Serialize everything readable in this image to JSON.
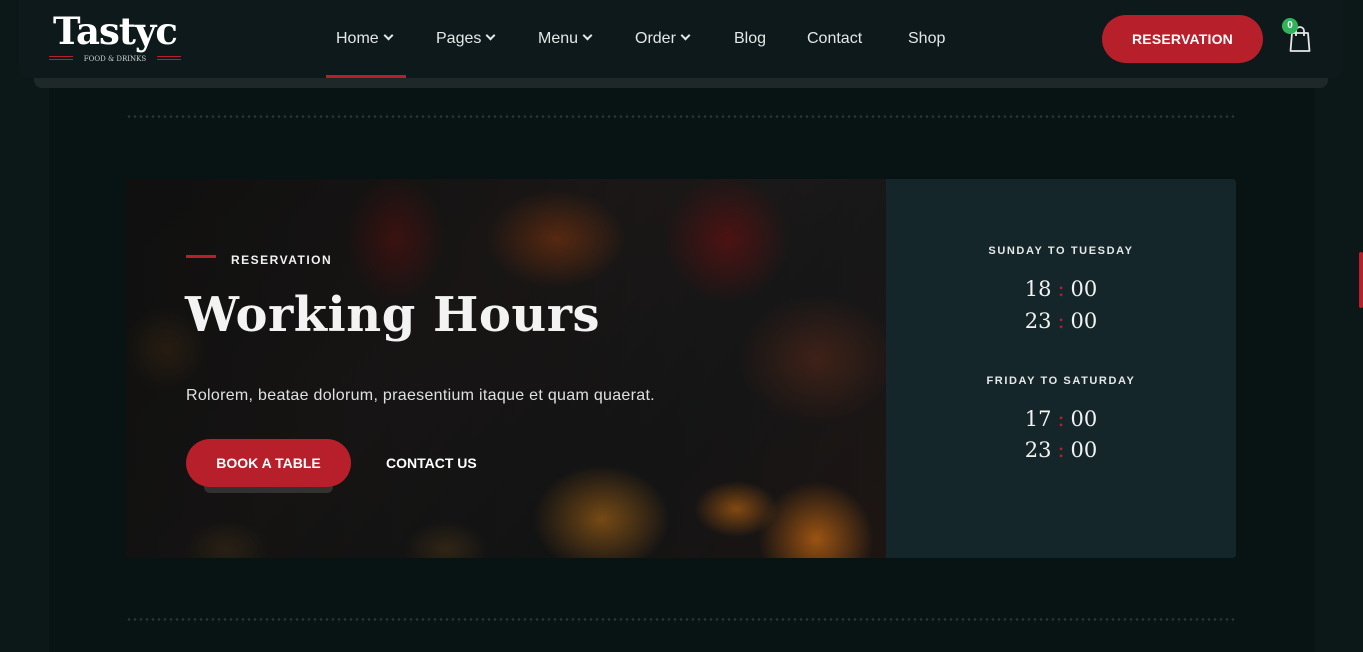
{
  "header": {
    "logo": {
      "name": "Tastyc",
      "tagline": "FOOD & DRINKS"
    },
    "nav": [
      {
        "label": "Home",
        "dropdown": true,
        "active": true
      },
      {
        "label": "Pages",
        "dropdown": true
      },
      {
        "label": "Menu",
        "dropdown": true
      },
      {
        "label": "Order",
        "dropdown": true
      },
      {
        "label": "Blog",
        "dropdown": false
      },
      {
        "label": "Contact",
        "dropdown": false
      },
      {
        "label": "Shop",
        "dropdown": false
      }
    ],
    "reservation_button": "RESERVATION",
    "cart": {
      "icon": "shopping-bag-icon",
      "count": "0"
    }
  },
  "hero": {
    "eyebrow": "RESERVATION",
    "title": "Working Hours",
    "description": "Rolorem, beatae dolorum, praesentium itaque et quam quaerat.",
    "book_button": "BOOK A TABLE",
    "contact_link": "CONTACT US"
  },
  "hours": [
    {
      "days": "SUNDAY TO TUESDAY",
      "open": {
        "h": "18",
        "m": "00"
      },
      "close": {
        "h": "23",
        "m": "00"
      }
    },
    {
      "days": "FRIDAY TO SATURDAY",
      "open": {
        "h": "17",
        "m": "00"
      },
      "close": {
        "h": "23",
        "m": "00"
      }
    }
  ],
  "colors": {
    "accent": "#b7202a",
    "background": "#081314",
    "card": "#15262a",
    "badge": "#2fb45a"
  }
}
